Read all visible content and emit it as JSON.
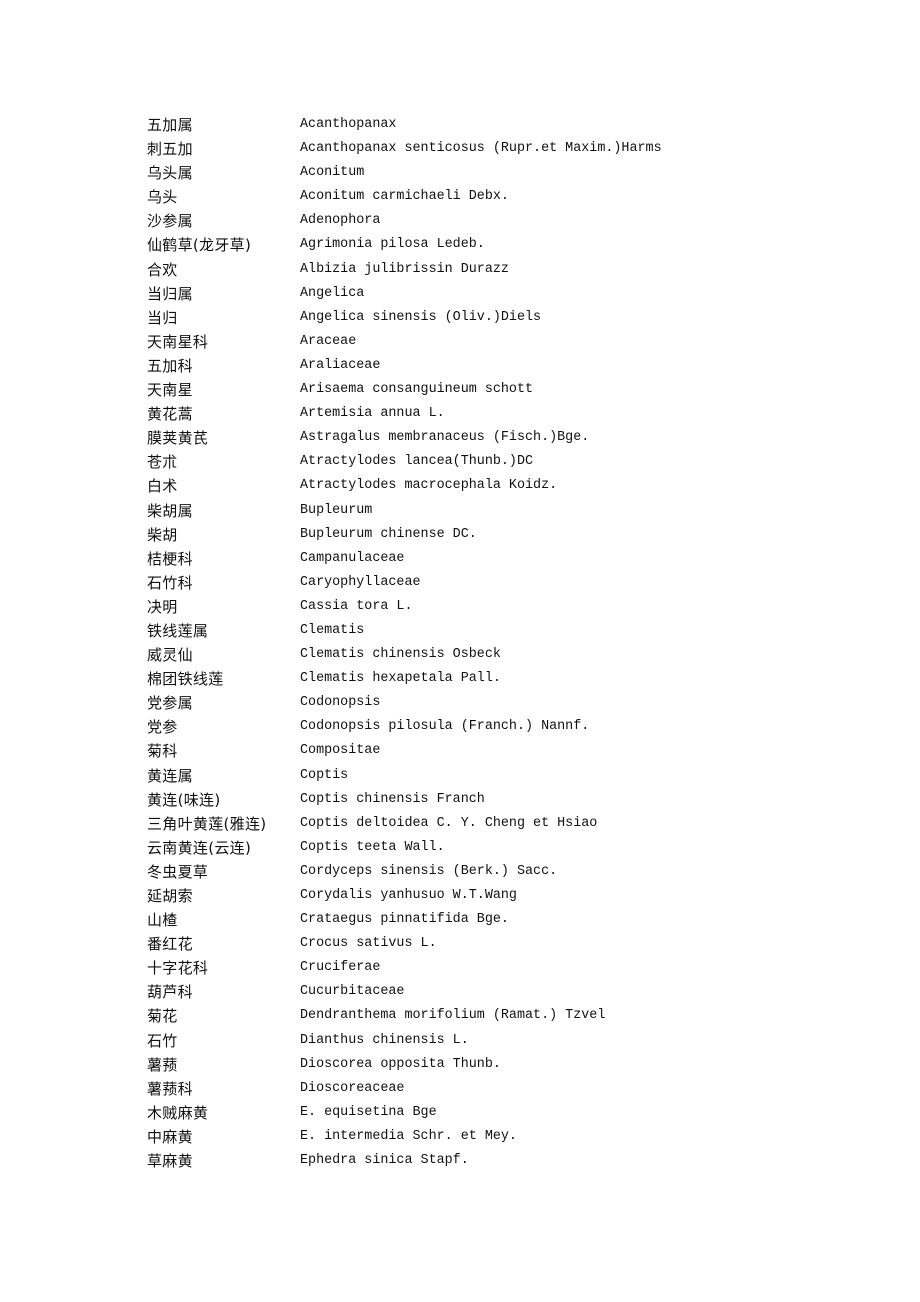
{
  "entries": [
    {
      "chinese": "五加属",
      "latin": "Acanthopanax"
    },
    {
      "chinese": "刺五加",
      "latin": "Acanthopanax senticosus (Rupr.et Maxim.)Harms"
    },
    {
      "chinese": "乌头属",
      "latin": "Aconitum"
    },
    {
      "chinese": "乌头",
      "latin": "Aconitum carmichaeli Debx."
    },
    {
      "chinese": "沙参属",
      "latin": "Adenophora"
    },
    {
      "chinese": "仙鹤草(龙牙草)",
      "latin": "Agrimonia pilosa Ledeb."
    },
    {
      "chinese": "合欢",
      "latin": "Albizia julibrissin Durazz"
    },
    {
      "chinese": "当归属",
      "latin": "Angelica"
    },
    {
      "chinese": "当归",
      "latin": "Angelica sinensis (Oliv.)Diels"
    },
    {
      "chinese": "天南星科",
      "latin": "Araceae"
    },
    {
      "chinese": "五加科",
      "latin": "Araliaceae"
    },
    {
      "chinese": "天南星",
      "latin": "Arisaema consanguineum schott"
    },
    {
      "chinese": "黄花蒿",
      "latin": "Artemisia annua L."
    },
    {
      "chinese": "膜荚黄芪",
      "latin": "Astragalus membranaceus (Fisch.)Bge."
    },
    {
      "chinese": "苍朮",
      "latin": "Atractylodes lancea(Thunb.)DC"
    },
    {
      "chinese": "白术",
      "latin": "Atractylodes macrocephala Koidz."
    },
    {
      "chinese": "柴胡属",
      "latin": "Bupleurum"
    },
    {
      "chinese": "柴胡",
      "latin": "Bupleurum chinense DC."
    },
    {
      "chinese": "桔梗科",
      "latin": "Campanulaceae"
    },
    {
      "chinese": "石竹科",
      "latin": "Caryophyllaceae"
    },
    {
      "chinese": "决明",
      "latin": "Cassia tora L."
    },
    {
      "chinese": "铁线莲属",
      "latin": "Clematis"
    },
    {
      "chinese": "威灵仙",
      "latin": "Clematis chinensis Osbeck"
    },
    {
      "chinese": "棉团铁线莲",
      "latin": "Clematis hexapetala Pall."
    },
    {
      "chinese": "党参属",
      "latin": "Codonopsis"
    },
    {
      "chinese": "党参",
      "latin": "Codonopsis pilosula (Franch.) Nannf."
    },
    {
      "chinese": "菊科",
      "latin": "Compositae"
    },
    {
      "chinese": "黄连属",
      "latin": "Coptis"
    },
    {
      "chinese": "黄连(味连)",
      "latin": "Coptis chinensis Franch"
    },
    {
      "chinese": "三角叶黄莲(雅连)",
      "latin": "Coptis deltoidea C. Y. Cheng et Hsiao"
    },
    {
      "chinese": "云南黄连(云连)",
      "latin": "Coptis teeta Wall."
    },
    {
      "chinese": "冬虫夏草",
      "latin": "Cordyceps sinensis (Berk.) Sacc."
    },
    {
      "chinese": "延胡索",
      "latin": "Corydalis yanhusuo W.T.Wang"
    },
    {
      "chinese": "山楂",
      "latin": "Crataegus pinnatifida Bge."
    },
    {
      "chinese": "番红花",
      "latin": "Crocus sativus L."
    },
    {
      "chinese": "十字花科",
      "latin": "Cruciferae"
    },
    {
      "chinese": "葫芦科",
      "latin": "Cucurbitaceae"
    },
    {
      "chinese": "菊花",
      "latin": "Dendranthema morifolium (Ramat.) Tzvel"
    },
    {
      "chinese": "石竹",
      "latin": "Dianthus chinensis L."
    },
    {
      "chinese": "薯蓣",
      "latin": "Dioscorea opposita Thunb."
    },
    {
      "chinese": "薯蓣科",
      "latin": "Dioscoreaceae"
    },
    {
      "chinese": "木贼麻黄",
      "latin": "E. equisetina Bge"
    },
    {
      "chinese": "中麻黄",
      "latin": "E. intermedia Schr. et Mey."
    },
    {
      "chinese": "草麻黄",
      "latin": "Ephedra sinica Stapf."
    }
  ]
}
